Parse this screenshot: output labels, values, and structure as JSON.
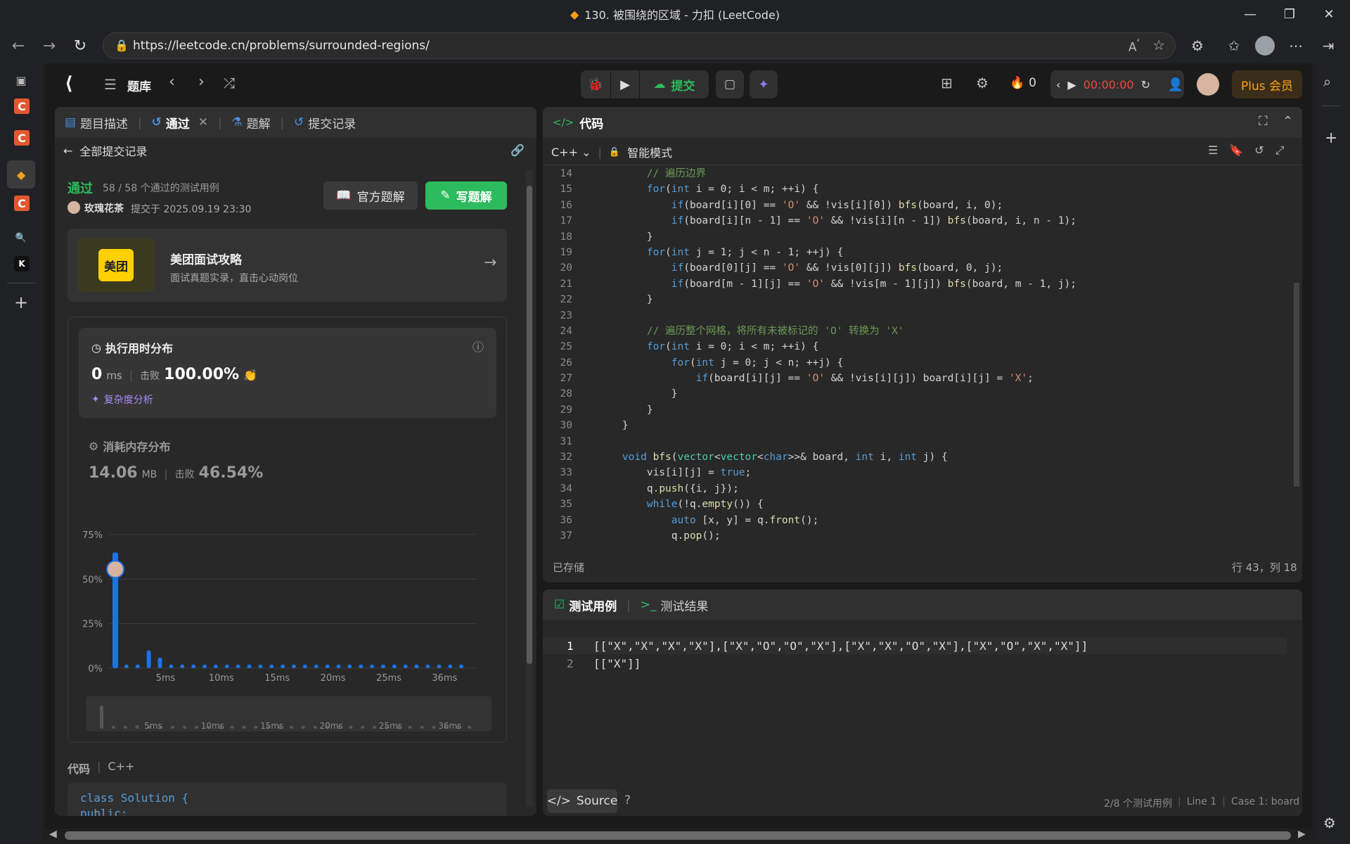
{
  "browser": {
    "tab_title": "130. 被围绕的区域 - 力扣 (LeetCode)",
    "url": "https://leetcode.cn/problems/surrounded-regions/"
  },
  "topnav": {
    "problem_list": "题库",
    "submit_label": "提交",
    "streak_count": "0",
    "timer": "00:00:00",
    "plus_label": "Plus 会员"
  },
  "left_tabs": [
    {
      "label": "题目描述"
    },
    {
      "label": "通过"
    },
    {
      "label": "题解"
    },
    {
      "label": "提交记录"
    }
  ],
  "submission": {
    "back_label": "全部提交记录",
    "status": "通过",
    "testcases": "58 / 58 个通过的测试用例",
    "user": "玫瑰花茶",
    "submitted_at": "提交于 2025.09.19 23:30",
    "official_solution": "官方题解",
    "write_solution": "写题解"
  },
  "promo": {
    "logo_text": "美团",
    "title": "美团面试攻略",
    "subtitle": "面试真题实录，直击心动岗位"
  },
  "runtime": {
    "title": "执行用时分布",
    "value": "0",
    "unit": "ms",
    "beats_label": "击败",
    "beats_value": "100.00%",
    "complexity_link": "复杂度分析"
  },
  "memory": {
    "title": "消耗内存分布",
    "value": "14.06",
    "unit": "MB",
    "beats_label": "击败",
    "beats_value": "46.54%"
  },
  "chart_data": {
    "type": "bar",
    "yticks": [
      "75%",
      "50%",
      "25%",
      "0%"
    ],
    "ylim": [
      0,
      75
    ],
    "xtick_labels": [
      "5ms",
      "10ms",
      "15ms",
      "20ms",
      "25ms",
      "36ms"
    ],
    "values": [
      65,
      2,
      2,
      10,
      6,
      2,
      2,
      2,
      2,
      2,
      2,
      2,
      2,
      2,
      2,
      2,
      2,
      2,
      2,
      2,
      2,
      2,
      2,
      2,
      2,
      2,
      2,
      2,
      2,
      2,
      2,
      2
    ],
    "highlight_index": 0
  },
  "bottom_code": {
    "header": "代码",
    "lang": "C++",
    "line1": "class Solution {",
    "line2": "public:"
  },
  "editor": {
    "title": "代码",
    "language": "C++",
    "mode": "智能模式",
    "saved": "已存储",
    "cursor": "行 43，列 18",
    "lines": [
      {
        "n": "14",
        "t": "        // 遍历边界"
      },
      {
        "n": "15",
        "t": "        for(int i = 0; i < m; ++i) {"
      },
      {
        "n": "16",
        "t": "            if(board[i][0] == 'O' && !vis[i][0]) bfs(board, i, 0);"
      },
      {
        "n": "17",
        "t": "            if(board[i][n - 1] == 'O' && !vis[i][n - 1]) bfs(board, i, n - 1);"
      },
      {
        "n": "18",
        "t": "        }"
      },
      {
        "n": "19",
        "t": "        for(int j = 1; j < n - 1; ++j) {"
      },
      {
        "n": "20",
        "t": "            if(board[0][j] == 'O' && !vis[0][j]) bfs(board, 0, j);"
      },
      {
        "n": "21",
        "t": "            if(board[m - 1][j] == 'O' && !vis[m - 1][j]) bfs(board, m - 1, j);"
      },
      {
        "n": "22",
        "t": "        }"
      },
      {
        "n": "23",
        "t": ""
      },
      {
        "n": "24",
        "t": "        // 遍历整个网格，将所有未被标记的 'O' 转换为 'X'"
      },
      {
        "n": "25",
        "t": "        for(int i = 0; i < m; ++i) {"
      },
      {
        "n": "26",
        "t": "            for(int j = 0; j < n; ++j) {"
      },
      {
        "n": "27",
        "t": "                if(board[i][j] == 'O' && !vis[i][j]) board[i][j] = 'X';"
      },
      {
        "n": "28",
        "t": "            }"
      },
      {
        "n": "29",
        "t": "        }"
      },
      {
        "n": "30",
        "t": "    }"
      },
      {
        "n": "31",
        "t": ""
      },
      {
        "n": "32",
        "t": "    void bfs(vector<vector<char>>& board, int i, int j) {"
      },
      {
        "n": "33",
        "t": "        vis[i][j] = true;"
      },
      {
        "n": "34",
        "t": "        q.push({i, j});"
      },
      {
        "n": "35",
        "t": "        while(!q.empty()) {"
      },
      {
        "n": "36",
        "t": "            auto [x, y] = q.front();"
      },
      {
        "n": "37",
        "t": "            q.pop();"
      }
    ]
  },
  "testcase": {
    "tab1": "测试用例",
    "tab2": "测试结果",
    "line1_no": "1",
    "line1": "[[\"X\",\"X\",\"X\",\"X\"],[\"X\",\"O\",\"O\",\"X\"],[\"X\",\"X\",\"O\",\"X\"],[\"X\",\"O\",\"X\",\"X\"]]",
    "line2_no": "2",
    "line2": "[[\"X\"]]",
    "source_btn": "Source",
    "status_cases": "2/8 个测试用例",
    "status_line": "Line 1",
    "status_case": "Case 1: board"
  }
}
